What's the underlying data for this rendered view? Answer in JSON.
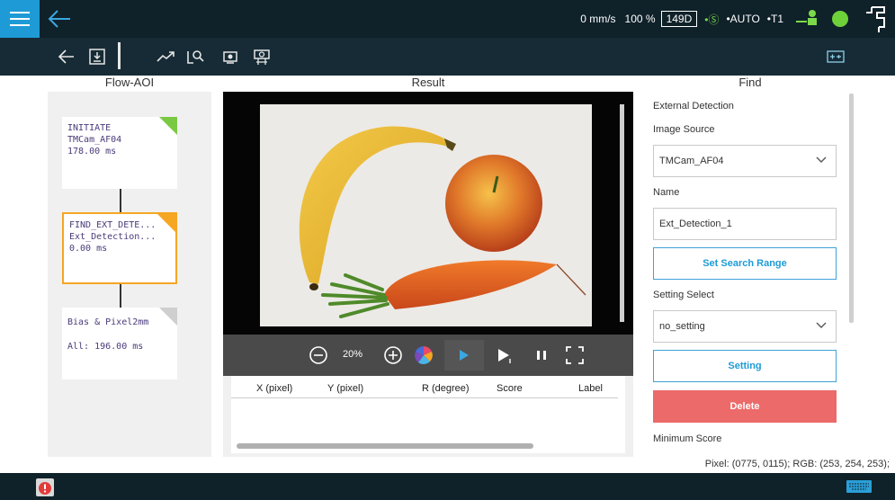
{
  "topbar": {
    "speed": "0 mm/s",
    "percent": "100 %",
    "vision_badge": "149D",
    "status_s": "•Ⓢ",
    "mode": "•AUTO",
    "t1": "•T1",
    "icons": [
      "menu-icon",
      "back-arrow-icon",
      "green-status-icon",
      "robot-arm-icon"
    ]
  },
  "toolbar": {
    "icons": [
      "back-arrow-icon",
      "save-icon",
      "separator",
      "trend-icon",
      "search-tool-icon",
      "camera-icon",
      "camera-settings-icon",
      "fit-view-icon"
    ]
  },
  "headers": {
    "flow": "Flow-AOI",
    "result": "Result",
    "find": "Find"
  },
  "flow": {
    "nodes": [
      {
        "line1": "INITIATE",
        "line2": "TMCam_AF04",
        "line3": "178.00 ms",
        "tri_color": "#7ac943"
      },
      {
        "line1": "FIND_EXT_DETE...",
        "line2": "Ext_Detection...",
        "line3": "0.00 ms",
        "tri_color": "#f5a623"
      },
      {
        "line1": "Bias & Pixel2mm",
        "line2": "",
        "line3": "All: 196.00 ms",
        "tri_color": "#cfcfcf"
      }
    ]
  },
  "result": {
    "zoom": "20%",
    "columns": [
      "X (pixel)",
      "Y (pixel)",
      "R (degree)",
      "Score",
      "Label"
    ]
  },
  "find": {
    "section": "External Detection",
    "image_source_label": "Image Source",
    "image_source_value": "TMCam_AF04",
    "name_label": "Name",
    "name_value": "Ext_Detection_1",
    "set_search_range": "Set Search Range",
    "setting_select_label": "Setting Select",
    "setting_select_value": "no_setting",
    "setting_button": "Setting",
    "delete_button": "Delete",
    "minimum_score_label": "Minimum Score"
  },
  "pixel_info": "Pixel: (0775, 0115); RGB: (253, 254, 253);",
  "colors": {
    "topbar": "#0f2129",
    "accent": "#1e9bd6",
    "delete": "#ec6a6a",
    "ok_green": "#6fd13a"
  }
}
